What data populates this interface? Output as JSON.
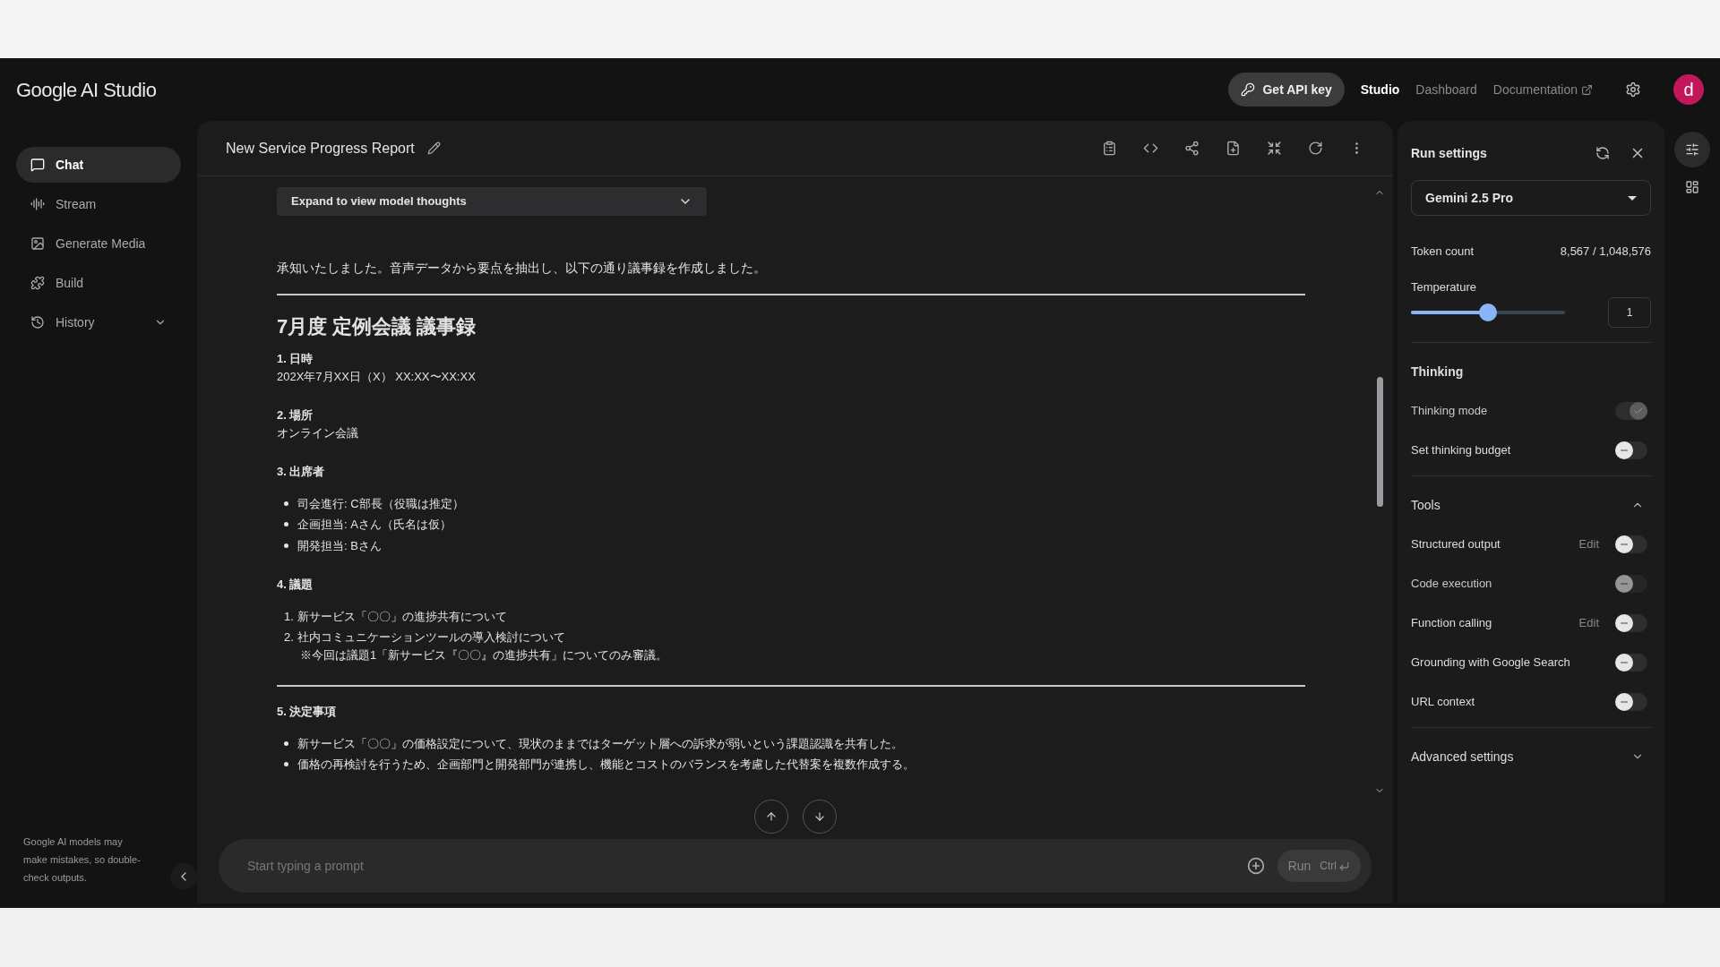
{
  "header": {
    "logo": "Google AI Studio",
    "api_key_button": "Get API key",
    "nav": [
      {
        "label": "Studio",
        "selected": true
      },
      {
        "label": "Dashboard",
        "selected": false
      },
      {
        "label": "Documentation",
        "selected": false,
        "external": true
      }
    ],
    "avatar": "d"
  },
  "sidebar": {
    "items": [
      {
        "label": "Chat",
        "selected": true
      },
      {
        "label": "Stream",
        "selected": false
      },
      {
        "label": "Generate Media",
        "selected": false
      },
      {
        "label": "Build",
        "selected": false
      },
      {
        "label": "History",
        "selected": false,
        "expandable": true
      }
    ],
    "disclaimer": "Google AI models may make mistakes, so double-check outputs."
  },
  "chat": {
    "title": "New Service Progress Report",
    "thoughts_button": "Expand to view model thoughts",
    "blocks": [
      {
        "kind": "paragraph",
        "text": "承知いたしました。音声データから要点を抽出し、以下の通り議事録を作成しました。"
      },
      {
        "kind": "divider"
      },
      {
        "kind": "title",
        "text": "7月度 定例会議 議事録"
      },
      {
        "kind": "section",
        "heading": "1. 日時",
        "lines": [
          "202X年7月XX日（X） XX:XX〜XX:XX"
        ]
      },
      {
        "kind": "section",
        "heading": "2. 場所",
        "lines": [
          "オンライン会議"
        ]
      },
      {
        "kind": "section",
        "heading": "3. 出席者",
        "bullets": [
          "司会進行: C部長（役職は推定）",
          "企画担当: Aさん（氏名は仮）",
          "開発担当: Bさん"
        ]
      },
      {
        "kind": "section",
        "heading": "4. 議題",
        "numbered": [
          {
            "number": "1.",
            "text": "新サービス「〇〇」の進捗共有について"
          },
          {
            "number": "2.",
            "text": "社内コミュニケーションツールの導入検討について",
            "note": "※今回は議題1「新サービス『〇〇』の進捗共有」についてのみ審議。"
          }
        ]
      },
      {
        "kind": "divider"
      },
      {
        "kind": "section",
        "heading": "5. 決定事項",
        "bullets": [
          "新サービス「〇〇」の価格設定について、現状のままではターゲット層への訴求が弱いという課題認識を共有した。",
          "価格の再検討を行うため、企画部門と開発部門が連携し、機能とコストのバランスを考慮した代替案を複数作成する。"
        ]
      }
    ],
    "prompt": {
      "placeholder": "Start typing a prompt"
    },
    "run_button": "Run",
    "run_shortcut": "Ctrl"
  },
  "run_settings": {
    "title": "Run settings",
    "model": "Gemini 2.5 Pro",
    "token_label": "Token count",
    "token_value": "8,567 / 1,048,576",
    "temperature": {
      "label": "Temperature",
      "level": 0.5,
      "value": "1"
    },
    "sections": [
      {
        "title": "Thinking",
        "items": [
          {
            "label": "Thinking mode",
            "on": true,
            "disabled": true
          },
          {
            "label": "Set thinking budget",
            "on": false,
            "disabled": false
          }
        ]
      },
      {
        "title": "Tools",
        "expanded": true,
        "items": [
          {
            "label": "Structured output",
            "edit": "Edit",
            "on": false,
            "disabled": false
          },
          {
            "label": "Code execution",
            "on": false,
            "disabled": true
          },
          {
            "label": "Function calling",
            "edit": "Edit",
            "on": false,
            "disabled": false
          },
          {
            "label": "Grounding with Google Search",
            "on": false,
            "disabled": false
          },
          {
            "label": "URL context",
            "on": false,
            "disabled": false
          }
        ]
      },
      {
        "title": "Advanced settings",
        "expanded": false
      }
    ]
  }
}
